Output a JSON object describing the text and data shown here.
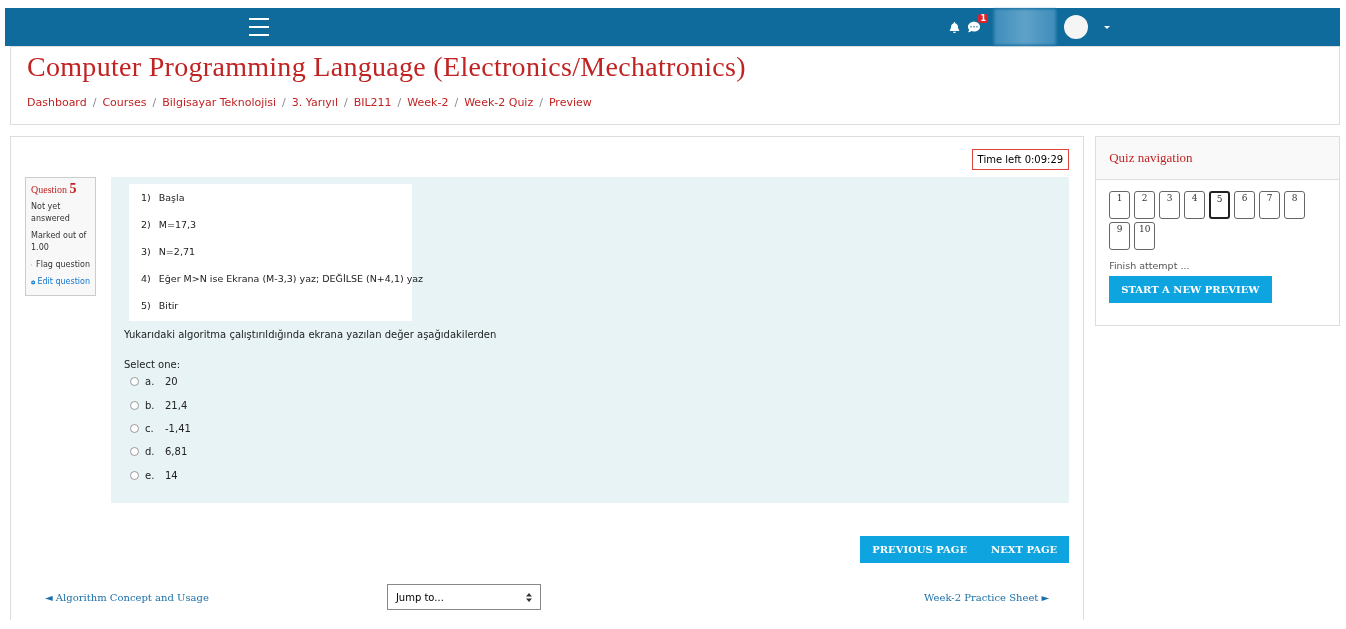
{
  "navbar": {
    "notification_count": "1"
  },
  "header": {
    "title": "Computer Programming Language (Electronics/Mechatronics)",
    "breadcrumb_separator": "/",
    "breadcrumbs": [
      "Dashboard",
      "Courses",
      "Bilgisayar Teknolojisi",
      "3. Yarıyıl",
      "BIL211",
      "Week-2",
      "Week-2 Quiz",
      "Preview"
    ]
  },
  "timer": "Time left 0:09:29",
  "question_info": {
    "label": "Question",
    "number": "5",
    "status": "Not yet answered",
    "mark": "Marked out of 1.00",
    "flag": "Flag question",
    "edit": "Edit question"
  },
  "algorithm_steps": [
    {
      "number": "1)",
      "text": "Başla"
    },
    {
      "number": "2)",
      "text": "M=17,3"
    },
    {
      "number": "3)",
      "text": "N=2,71"
    },
    {
      "number": "4)",
      "text": "Eğer M>N ise Ekrana (M-3,3) yaz; DEĞİLSE (N+4,1) yaz"
    },
    {
      "number": "5)",
      "text": "Bitir"
    }
  ],
  "question_text": "Yukarıdaki algoritma çalıştırıldığında ekrana yazılan değer aşağıdakilerden",
  "prompt": "Select one:",
  "options": [
    {
      "letter": "a.",
      "text": "20",
      "checked": false
    },
    {
      "letter": "b.",
      "text": "21,4",
      "checked": false
    },
    {
      "letter": "c.",
      "text": "-1,41",
      "checked": false
    },
    {
      "letter": "d.",
      "text": "6,81",
      "checked": false
    },
    {
      "letter": "e.",
      "text": "14",
      "checked": false
    }
  ],
  "page_buttons": [
    "PREVIOUS PAGE",
    "NEXT PAGE"
  ],
  "activity_nav": {
    "previous": "◄ Algorithm Concept and Usage",
    "jump": "Jump to...",
    "next": "Week-2 Practice Sheet ►"
  },
  "quiz_navigation": {
    "title": "Quiz navigation",
    "questions": [
      {
        "label": "1",
        "selected": false
      },
      {
        "label": "2",
        "selected": false
      },
      {
        "label": "3",
        "selected": false
      },
      {
        "label": "4",
        "selected": false
      },
      {
        "label": "5",
        "selected": true
      },
      {
        "label": "6",
        "selected": false
      },
      {
        "label": "7",
        "selected": false
      },
      {
        "label": "8",
        "selected": false
      },
      {
        "label": "9",
        "selected": false
      },
      {
        "label": "10",
        "selected": false
      }
    ],
    "finish": "Finish attempt ...",
    "button": "START A NEW PREVIEW"
  }
}
